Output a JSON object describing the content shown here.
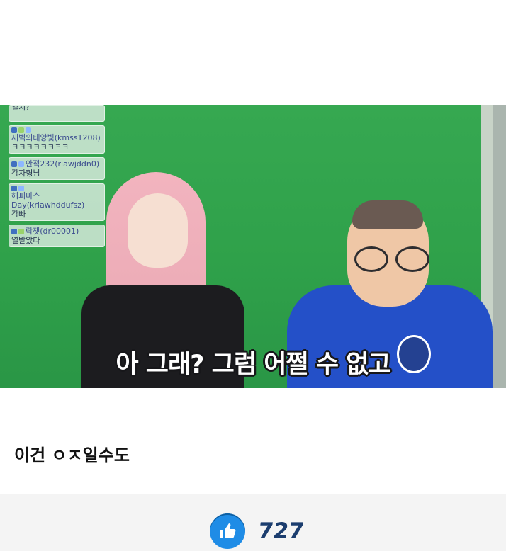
{
  "video": {
    "chat_messages": [
      {
        "username": "",
        "text": "일지?"
      },
      {
        "username": "새벽의태양빛(kmss1208)",
        "text": "ㅋㅋㅋㅋㅋㅋㅋㅋ"
      },
      {
        "username": "안적232(riawjddn0)",
        "text": "감자형님"
      },
      {
        "username": "헤피마스Day(kriawhddufsz)",
        "text": "감빠"
      },
      {
        "username": "락잿(dr00001)",
        "text": "열받았다"
      }
    ],
    "subtitle": "아 그래? 그럼 어쩔 수 없고"
  },
  "post": {
    "text": "이건 ㅇㅈ일수도"
  },
  "reaction": {
    "icon": "thumbs-up-icon",
    "count": "727",
    "accent_color": "#1f8ce6"
  }
}
